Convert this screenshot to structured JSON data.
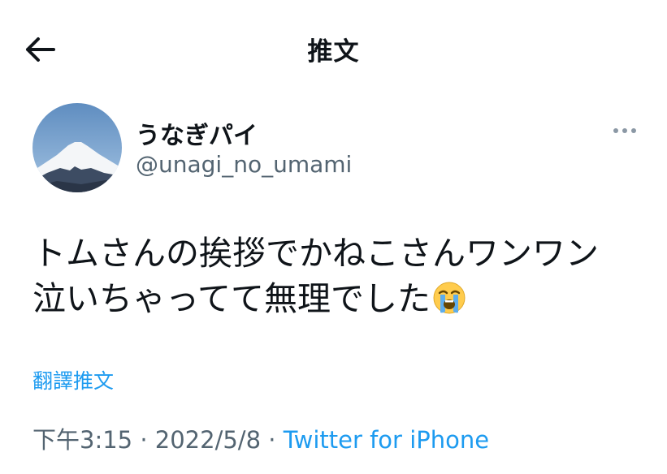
{
  "header": {
    "title": "推文",
    "back_icon": "arrow-left-icon"
  },
  "tweet": {
    "author": {
      "display_name": "うなぎパイ",
      "handle": "@unagi_no_umami",
      "avatar": "mount-fuji-photo"
    },
    "more_icon": "more-horizontal-icon",
    "text_line1": "トムさんの挨拶でかねこさんワンワン",
    "text_line2": "泣いちゃってて無理でした",
    "emoji": "loudly-crying-face-emoji",
    "translate_label": "翻譯推文",
    "time": "下午3:15",
    "sep1": " · ",
    "date": "2022/5/8",
    "sep2": " · ",
    "source": "Twitter for iPhone"
  },
  "colors": {
    "accent": "#1d9bf0",
    "secondary_text": "#536471",
    "primary_text": "#0f1419"
  }
}
